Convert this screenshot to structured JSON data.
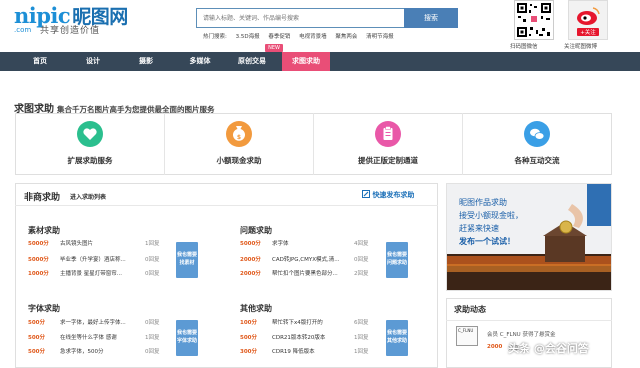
{
  "header": {
    "logo": "nipic",
    "logo_cn": "昵图网",
    "logo_domain": ".com",
    "slogan": "共享创造价值",
    "search_placeholder": "请输入标题、关键词、作品编号搜索",
    "search_button": "搜索",
    "hot_label": "热门搜索:",
    "hot_keywords": [
      "3.5D海报",
      "春季促销",
      "电视背景墙",
      "聚焦两会",
      "清明节海报"
    ],
    "qr_label": "扫码图微信",
    "weibo_follow": "+关注",
    "weibo_label": "关注昵图微博"
  },
  "nav": {
    "items": [
      "首页",
      "设计",
      "摄影",
      "多媒体",
      "原创交易",
      "求图求助"
    ],
    "active": "求图求助",
    "new_badge": "NEW"
  },
  "headline": {
    "main": "求图求助",
    "sub": "集合千万名图片高手为您提供最全面的图片服务"
  },
  "services": [
    {
      "label": "扩展求助服务",
      "color": "#2bbf8e",
      "icon": "heart-icon"
    },
    {
      "label": "小额现金求助",
      "color": "#f29a3e",
      "icon": "money-icon"
    },
    {
      "label": "提供正版定制通道",
      "color": "#e958a8",
      "icon": "clipboard-icon"
    },
    {
      "label": "各种互动交流",
      "color": "#3a9fe6",
      "icon": "chat-icon"
    }
  ],
  "panel": {
    "title": "非商求助",
    "subtitle": "进入求助列表",
    "publish": "快速发布求助"
  },
  "sections": [
    {
      "title": "素材求助",
      "button": "我也需要找素材",
      "rows": [
        {
          "amount": "5000分",
          "desc": "古风镜头图片",
          "replies": "1回复"
        },
        {
          "amount": "5000分",
          "desc": "毕业季（升学宴）酒店称...",
          "replies": "0回复"
        },
        {
          "amount": "1000分",
          "desc": "主播背景 星星灯带窗帘...",
          "replies": "0回复"
        }
      ]
    },
    {
      "title": "问题求助",
      "button": "我也需要问题求助",
      "rows": [
        {
          "amount": "5000分",
          "desc": "求字体",
          "replies": "4回复"
        },
        {
          "amount": "2000分",
          "desc": "CAD转JPG,CMYX模式,清...",
          "replies": "0回复"
        },
        {
          "amount": "2000分",
          "desc": "帮忙扣个图片要黑色部分...",
          "replies": "2回复"
        }
      ]
    },
    {
      "title": "字体求助",
      "button": "我也需要字体求助",
      "rows": [
        {
          "amount": "500分",
          "desc": "求一字体，最好上传字体...",
          "replies": "0回复"
        },
        {
          "amount": "500分",
          "desc": "在线坐等什么字体 感谢",
          "replies": "1回复"
        },
        {
          "amount": "500分",
          "desc": "急求字体，500分",
          "replies": "0回复"
        }
      ]
    },
    {
      "title": "其他求助",
      "button": "我也需要其他求助",
      "rows": [
        {
          "amount": "100分",
          "desc": "帮忙转下x4版打开的",
          "replies": "6回复"
        },
        {
          "amount": "500分",
          "desc": "CDR21版本转20版本",
          "replies": "1回复"
        },
        {
          "amount": "300分",
          "desc": "CDR19 降低版本",
          "replies": "1回复"
        }
      ]
    }
  ],
  "banner": {
    "line1": "昵图作品求助",
    "line2": "接受小额现金啦，",
    "line3": "赶紧来快速",
    "line4": "发布一个试试！"
  },
  "dynamics": {
    "title": "求助动态",
    "avatar_text": "C_FLNU",
    "text": "会员 C_FLNU 获得了悬赏金",
    "amount": "2000",
    "amount_suffix": "共享分",
    "watermark": "头条 @会谷问答"
  }
}
